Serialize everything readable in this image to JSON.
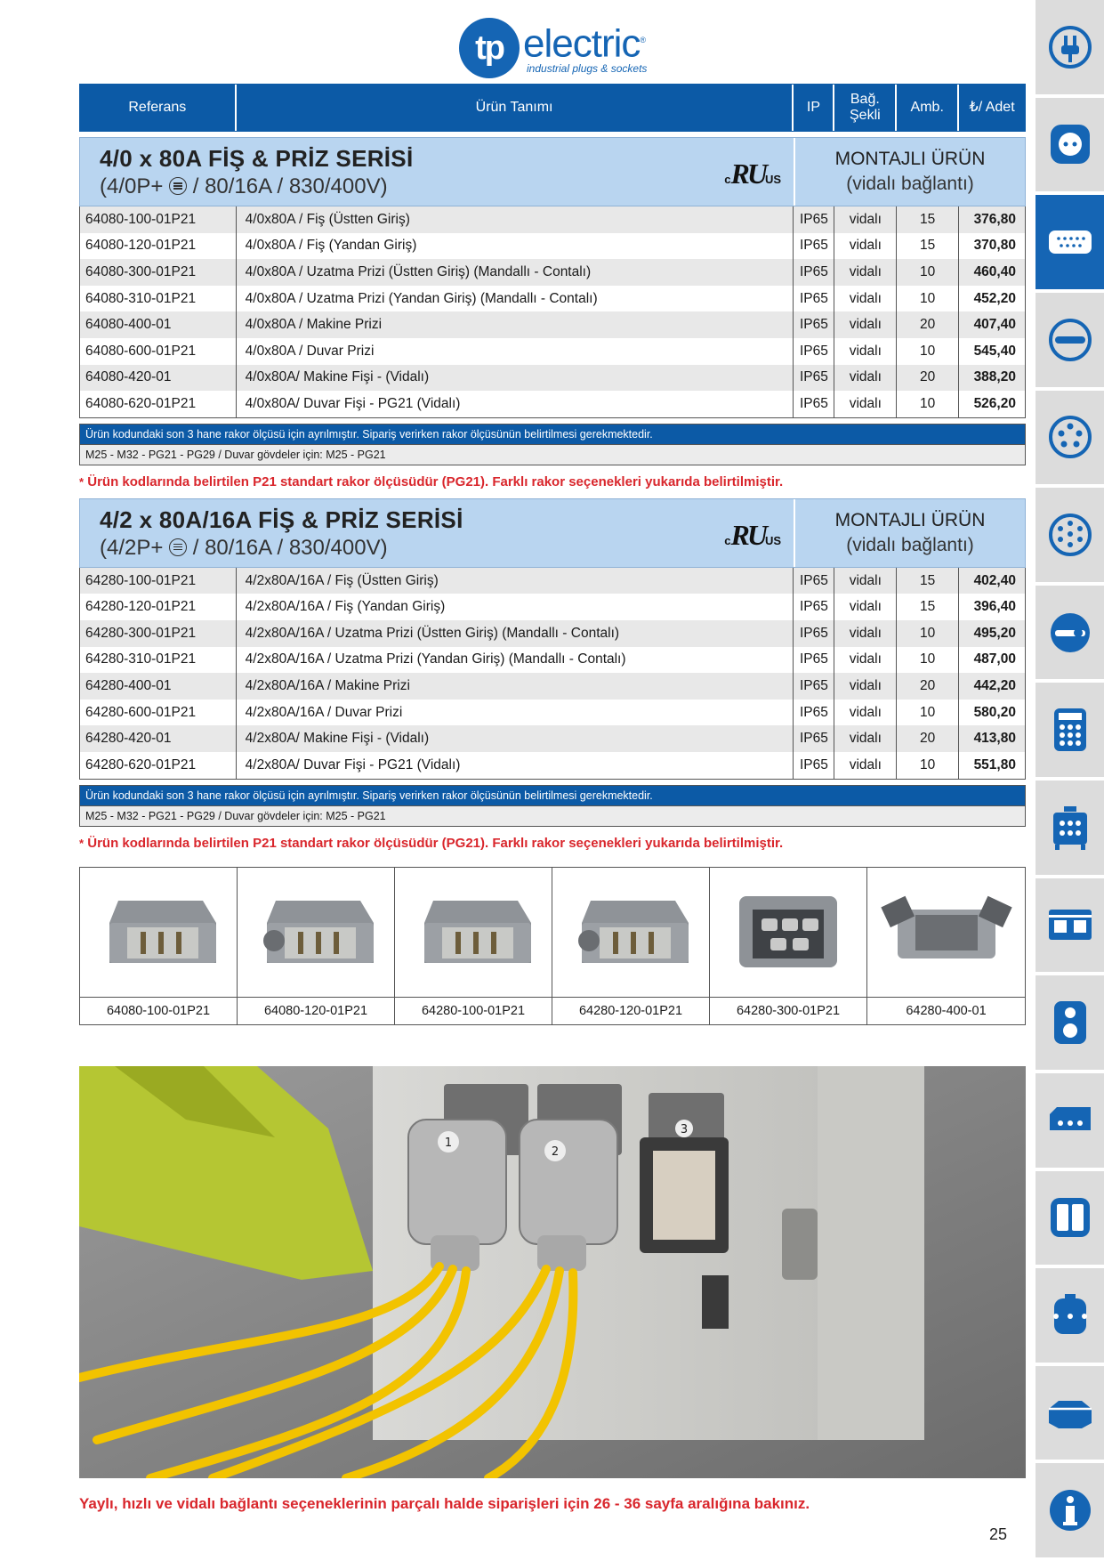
{
  "logo": {
    "mark": "tp",
    "word": "electric",
    "reg": "®",
    "tagline": "industrial plugs & sockets"
  },
  "header": {
    "referans": "Referans",
    "urun_tanimi": "Ürün Tanımı",
    "ip": "IP",
    "bag_sekli": "Bağ. Şekli",
    "amb": "Amb.",
    "fiyat": "₺/ Adet"
  },
  "series": [
    {
      "title": "4/0 x 80A FİŞ & PRİZ SERİSİ",
      "sub_a": "(4/0P+",
      "sub_b": "/ 80/16A / 830/400V)",
      "cert_c": "c",
      "cert_ul": "RU",
      "cert_us": "US",
      "mont_title": "MONTAJLI ÜRÜN",
      "mont_sub": "(vidalı bağlantı)",
      "rows": [
        {
          "ref": "64080-100-01P21",
          "desc": "4/0x80A / Fiş (Üstten Giriş)",
          "ip": "IP65",
          "bag": "vidalı",
          "amb": "15",
          "price": "376,80"
        },
        {
          "ref": "64080-120-01P21",
          "desc": "4/0x80A / Fiş (Yandan Giriş)",
          "ip": "IP65",
          "bag": "vidalı",
          "amb": "15",
          "price": "370,80"
        },
        {
          "ref": "64080-300-01P21",
          "desc": "4/0x80A / Uzatma Prizi (Üstten Giriş) (Mandallı - Contalı)",
          "ip": "IP65",
          "bag": "vidalı",
          "amb": "10",
          "price": "460,40"
        },
        {
          "ref": "64080-310-01P21",
          "desc": "4/0x80A / Uzatma Prizi (Yandan Giriş) (Mandallı - Contalı)",
          "ip": "IP65",
          "bag": "vidalı",
          "amb": "10",
          "price": "452,20"
        },
        {
          "ref": "64080-400-01",
          "desc": "4/0x80A / Makine Prizi",
          "ip": "IP65",
          "bag": "vidalı",
          "amb": "20",
          "price": "407,40"
        },
        {
          "ref": "64080-600-01P21",
          "desc": "4/0x80A / Duvar Prizi",
          "ip": "IP65",
          "bag": "vidalı",
          "amb": "10",
          "price": "545,40"
        },
        {
          "ref": "64080-420-01",
          "desc": "4/0x80A/ Makine Fişi - (Vidalı)",
          "ip": "IP65",
          "bag": "vidalı",
          "amb": "20",
          "price": "388,20"
        },
        {
          "ref": "64080-620-01P21",
          "desc": "4/0x80A/ Duvar Fişi - PG21 (Vidalı)",
          "ip": "IP65",
          "bag": "vidalı",
          "amb": "10",
          "price": "526,20"
        }
      ],
      "note_blue": "Ürün kodundaki son 3 hane rakor ölçüsü için ayrılmıştır. Sipariş verirken rakor ölçüsünün belirtilmesi gerekmektedir.",
      "note_gray": "M25 - M32 - PG21 - PG29 / Duvar gövdeler için: M25 - PG21",
      "note_red_star": "*",
      "note_red": "Ürün kodlarında belirtilen P21 standart rakor ölçüsüdür (PG21). Farklı rakor seçenekleri yukarıda belirtilmiştir."
    },
    {
      "title": "4/2 x 80A/16A FİŞ & PRİZ SERİSİ",
      "sub_a": "(4/2P+",
      "sub_b": "/ 80/16A / 830/400V)",
      "cert_c": "c",
      "cert_ul": "RU",
      "cert_us": "US",
      "mont_title": "MONTAJLI ÜRÜN",
      "mont_sub": "(vidalı bağlantı)",
      "rows": [
        {
          "ref": "64280-100-01P21",
          "desc": "4/2x80A/16A / Fiş (Üstten Giriş)",
          "ip": "IP65",
          "bag": "vidalı",
          "amb": "15",
          "price": "402,40"
        },
        {
          "ref": "64280-120-01P21",
          "desc": "4/2x80A/16A / Fiş (Yandan Giriş)",
          "ip": "IP65",
          "bag": "vidalı",
          "amb": "15",
          "price": "396,40"
        },
        {
          "ref": "64280-300-01P21",
          "desc": "4/2x80A/16A / Uzatma Prizi (Üstten Giriş) (Mandallı - Contalı)",
          "ip": "IP65",
          "bag": "vidalı",
          "amb": "10",
          "price": "495,20"
        },
        {
          "ref": "64280-310-01P21",
          "desc": "4/2x80A/16A / Uzatma Prizi (Yandan Giriş) (Mandallı - Contalı)",
          "ip": "IP65",
          "bag": "vidalı",
          "amb": "10",
          "price": "487,00"
        },
        {
          "ref": "64280-400-01",
          "desc": "4/2x80A/16A / Makine Prizi",
          "ip": "IP65",
          "bag": "vidalı",
          "amb": "20",
          "price": "442,20"
        },
        {
          "ref": "64280-600-01P21",
          "desc": "4/2x80A/16A / Duvar Prizi",
          "ip": "IP65",
          "bag": "vidalı",
          "amb": "10",
          "price": "580,20"
        },
        {
          "ref": "64280-420-01",
          "desc": "4/2x80A/ Makine Fişi - (Vidalı)",
          "ip": "IP65",
          "bag": "vidalı",
          "amb": "20",
          "price": "413,80"
        },
        {
          "ref": "64280-620-01P21",
          "desc": "4/2x80A/ Duvar Fişi - PG21 (Vidalı)",
          "ip": "IP65",
          "bag": "vidalı",
          "amb": "10",
          "price": "551,80"
        }
      ],
      "note_blue": "Ürün kodundaki son 3 hane rakor ölçüsü için ayrılmıştır. Sipariş verirken rakor ölçüsünün belirtilmesi gerekmektedir.",
      "note_gray": "M25 - M32 - PG21 - PG29 / Duvar gövdeler için: M25 - PG21",
      "note_red_star": "*",
      "note_red": "Ürün kodlarında belirtilen P21 standart rakor ölçüsüdür (PG21). Farklı rakor seçenekleri yukarıda belirtilmiştir."
    }
  ],
  "product_images": [
    {
      "caption": "64080-100-01P21",
      "kind": "plug-top"
    },
    {
      "caption": "64080-120-01P21",
      "kind": "plug-side"
    },
    {
      "caption": "64280-100-01P21",
      "kind": "plug-top"
    },
    {
      "caption": "64280-120-01P21",
      "kind": "plug-side"
    },
    {
      "caption": "64280-300-01P21",
      "kind": "socket"
    },
    {
      "caption": "64280-400-01",
      "kind": "machine-socket"
    }
  ],
  "photo": {
    "labels": [
      "1",
      "2",
      "3"
    ]
  },
  "footnote": "Yaylı, hızlı ve vidalı bağlantı seçeneklerinin parçalı halde siparişleri için 26 - 36 sayfa aralığına bakınız.",
  "page_number": "25",
  "sidebar": [
    {
      "icon": "plug-icon",
      "active": false
    },
    {
      "icon": "socket-icon",
      "active": false
    },
    {
      "icon": "industrial-connector-icon",
      "active": true
    },
    {
      "icon": "flat-connector-icon",
      "active": false
    },
    {
      "icon": "round-socket-icon",
      "active": false
    },
    {
      "icon": "multi-pin-socket-icon",
      "active": false
    },
    {
      "icon": "inlet-icon",
      "active": false
    },
    {
      "icon": "distribution-box-icon",
      "active": false
    },
    {
      "icon": "mobile-box-icon",
      "active": false
    },
    {
      "icon": "wall-box-icon",
      "active": false
    },
    {
      "icon": "switch-icon",
      "active": false
    },
    {
      "icon": "enclosure-icon",
      "active": false
    },
    {
      "icon": "double-panel-icon",
      "active": false
    },
    {
      "icon": "cylinder-box-icon",
      "active": false
    },
    {
      "icon": "hex-box-icon",
      "active": false
    },
    {
      "icon": "info-icon",
      "active": false
    }
  ],
  "colors": {
    "brand_blue": "#1565b4",
    "header_blue": "#0c5aa6",
    "series_bg": "#b9d5f0",
    "note_red": "#d9262c"
  }
}
